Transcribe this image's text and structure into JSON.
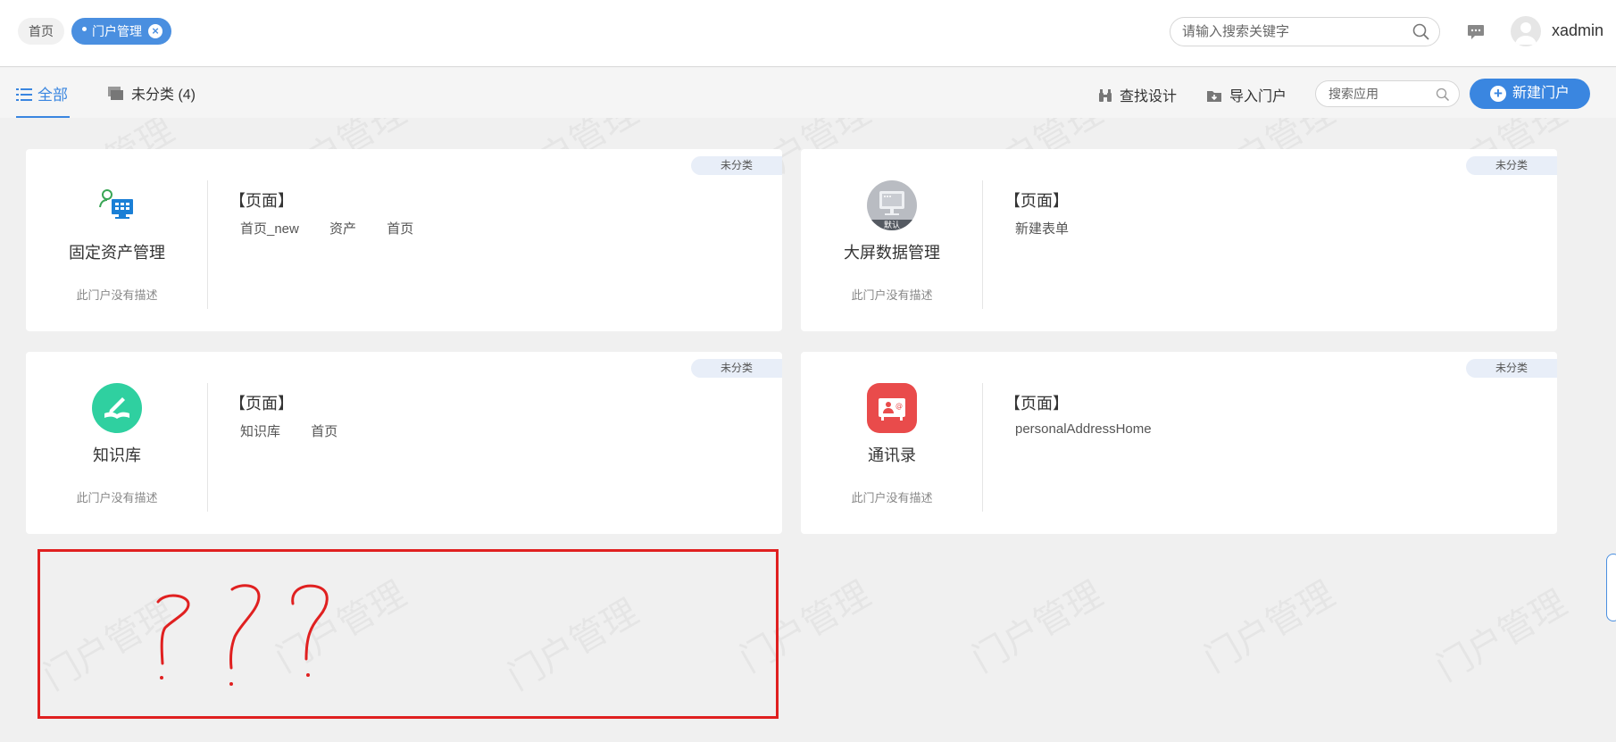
{
  "tabs_bar": {
    "home_label": "首页",
    "active_label": "门户管理"
  },
  "search": {
    "placeholder": "请输入搜索关键字"
  },
  "user": {
    "name": "xadmin"
  },
  "toolbar": {
    "tab_all": "全部",
    "tab_uncategorized": "未分类 (4)",
    "find_design": "查找设计",
    "import_portal": "导入门户",
    "app_search_placeholder": "搜索应用",
    "new_portal": "新建门户"
  },
  "watermark": "门户管理",
  "cards": [
    {
      "badge": "未分类",
      "name": "固定资产管理",
      "desc": "此门户没有描述",
      "section": "【页面】",
      "pages": [
        "首页_new",
        "资产",
        "首页"
      ],
      "icon": "asset-management-icon"
    },
    {
      "badge": "未分类",
      "name": "大屏数据管理",
      "desc": "此门户没有描述",
      "section": "【页面】",
      "pages": [
        "新建表单"
      ],
      "icon": "monitor-icon",
      "icon_badge": "默认"
    },
    {
      "badge": "未分类",
      "name": "知识库",
      "desc": "此门户没有描述",
      "section": "【页面】",
      "pages": [
        "知识库",
        "首页"
      ],
      "icon": "knowledge-book-icon"
    },
    {
      "badge": "未分类",
      "name": "通讯录",
      "desc": "此门户没有描述",
      "section": "【页面】",
      "pages": [
        "personalAddressHome"
      ],
      "icon": "address-book-icon"
    }
  ],
  "colors": {
    "accent": "#3a86e0",
    "annotation": "#e02020",
    "knowledge": "#2fd0a0",
    "address": "#e94b4b"
  }
}
